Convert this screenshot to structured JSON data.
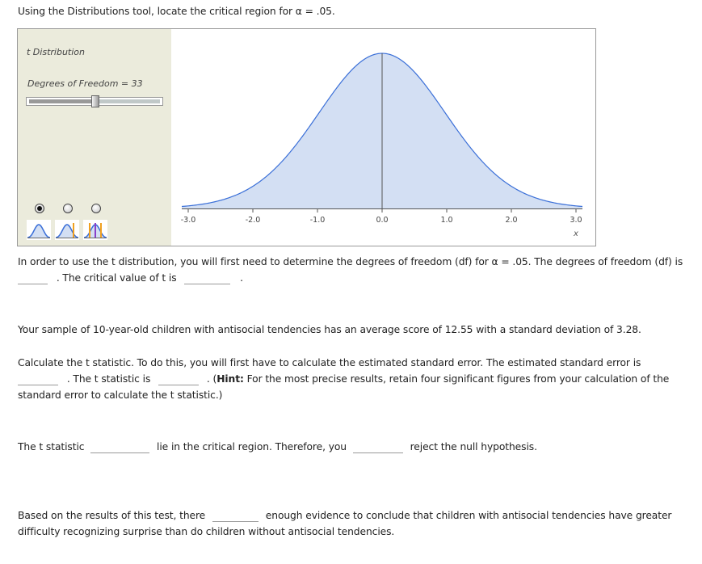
{
  "instruction": "Using the Distributions tool, locate the critical region for α = .05.",
  "tool": {
    "distribution_label": "t Distribution",
    "df_label": "Degrees of Freedom = 33",
    "df_value": 33,
    "df_slider_fraction": 0.5,
    "radio_options": [
      {
        "name": "plain-distribution",
        "selected": true
      },
      {
        "name": "one-tailed",
        "selected": false
      },
      {
        "name": "two-tailed",
        "selected": false
      }
    ],
    "colors": {
      "panel_bg": "#ebebdc",
      "curve": "#3a6fd8",
      "fill": "#d3dff3",
      "marker_orange": "#f0a020",
      "marker_purple": "#8a3fc8"
    }
  },
  "chart_data": {
    "type": "area",
    "title": "t Distribution",
    "distribution": "t",
    "df": 33,
    "xlabel": "x",
    "ylabel": "",
    "xlim": [
      -3.1,
      3.1
    ],
    "xticks": [
      -3.0,
      -2.0,
      -1.0,
      0.0,
      1.0,
      2.0,
      3.0
    ],
    "xtick_labels": [
      "-3.0",
      "-2.0",
      "-1.0",
      "0.0",
      "1.0",
      "2.0",
      "3.0"
    ],
    "center_line_x": 0.0,
    "grid": false,
    "legend": "none"
  },
  "q1": {
    "line1": "In order to use the t distribution, you will first need to determine the degrees of freedom (df) for α = .05. The degrees of freedom (df) is",
    "line2a": ". The critical value of t is",
    "line2b": ".",
    "df_answer": "",
    "critical_answer": ""
  },
  "sample_text": "Your sample of 10-year-old children with antisocial tendencies has an average score of 12.55 with a standard deviation of 3.28.",
  "q2": {
    "line1": "Calculate the t statistic. To do this, you will first have to calculate the estimated standard error. The estimated standard error is",
    "line2a": ". The t statistic is",
    "line2b": ". (",
    "hint_label": "Hint:",
    "line2c": " For the most precise results, retain four significant figures from your calculation of the",
    "line3": "standard error to calculate the t statistic.)",
    "se_answer": "",
    "t_answer": ""
  },
  "q3": {
    "part1": "The t statistic",
    "part2": "lie in the critical region. Therefore, you",
    "part3": "reject the null hypothesis.",
    "lie_answer": "",
    "reject_answer": ""
  },
  "q4": {
    "part1": "Based on the results of this test, there",
    "part2": "enough evidence to conclude that children with antisocial tendencies have greater",
    "line2": "difficulty recognizing surprise than do children without antisocial tendencies.",
    "evidence_answer": ""
  }
}
